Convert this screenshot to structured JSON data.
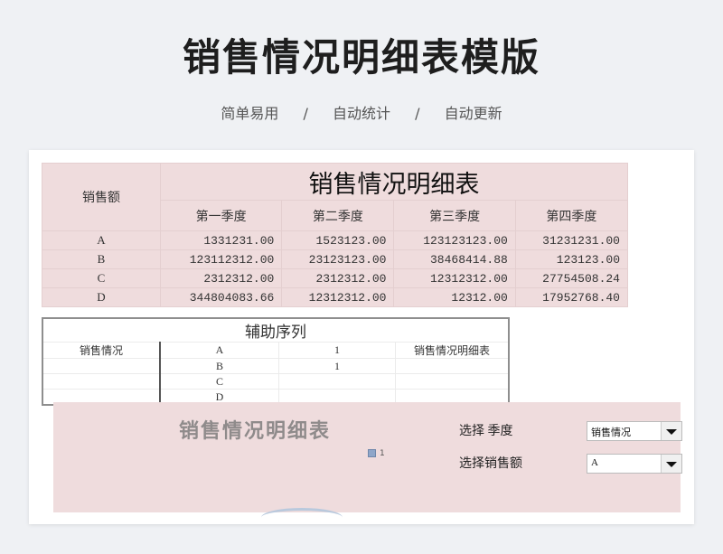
{
  "header": {
    "title": "销售情况明细表模版",
    "tags": [
      "简单易用",
      "/",
      "自动统计",
      "/",
      "自动更新"
    ]
  },
  "main_table": {
    "corner_label": "销售额",
    "title": "销售情况明细表",
    "quarters": [
      "第一季度",
      "第二季度",
      "第三季度",
      "第四季度"
    ],
    "rows": [
      {
        "label": "A",
        "values": [
          "1331231.00",
          "1523123.00",
          "123123123.00",
          "31231231.00"
        ]
      },
      {
        "label": "B",
        "values": [
          "123112312.00",
          "23123123.00",
          "38468414.88",
          "123123.00"
        ]
      },
      {
        "label": "C",
        "values": [
          "2312312.00",
          "2312312.00",
          "12312312.00",
          "27754508.24"
        ]
      },
      {
        "label": "D",
        "values": [
          "344804083.66",
          "12312312.00",
          "12312.00",
          "17952768.40"
        ]
      }
    ]
  },
  "aux_table": {
    "title": "辅助序列",
    "row_header": "销售情况",
    "labels": [
      "A",
      "B",
      "C",
      "D"
    ],
    "values": [
      "1",
      "1",
      "",
      ""
    ],
    "right_header": "销售情况明细表"
  },
  "panel": {
    "title": "销售情况明细表",
    "legend": "1",
    "select_quarter_label": "选择 季度",
    "select_quarter_value": "销售情况",
    "select_sales_label": "选择销售额",
    "select_sales_value": "A"
  }
}
